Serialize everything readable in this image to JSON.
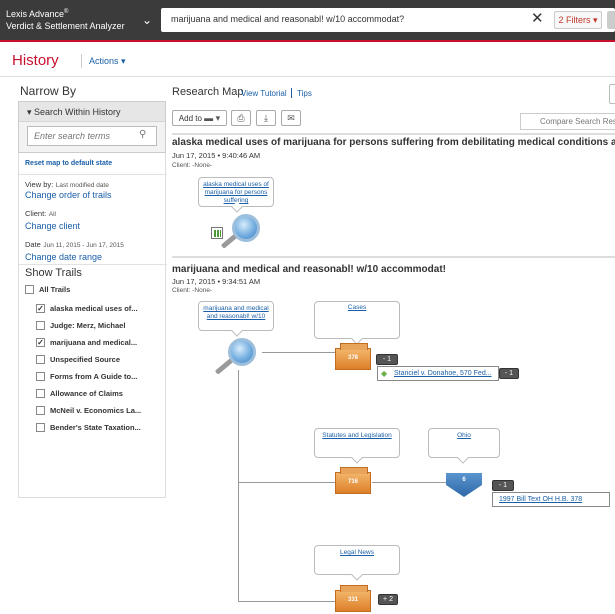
{
  "topbar": {
    "brand_line1": "Lexis Advance",
    "brand_sup": "®",
    "brand_line2": "Verdict & Settlement Analyzer",
    "chevron": "⌄",
    "search_value": "marijuana and medical and reasonabl! w/10 accommodat?",
    "clear_icon": "✕",
    "filters_label": "2 Filters ▾"
  },
  "header": {
    "title": "History",
    "actions_label": "Actions ▾"
  },
  "narrow_by": {
    "title": "Narrow By",
    "search_within_label": "▾ Search Within History",
    "search_placeholder": "Enter search terms",
    "search_icon": "⚲",
    "reset_link": "Reset map to default state",
    "view_by_label": "View by:",
    "view_by_value": "Last modified date",
    "change_order_link": "Change order of trails",
    "client_label": "Client:",
    "client_value": "All",
    "change_client_link": "Change client",
    "date_label": "Date",
    "date_value": "Jun 11, 2015 - Jun 17, 2015",
    "change_date_link": "Change date range",
    "show_trails_title": "Show Trails",
    "all_trails_label": "All Trails",
    "trails": [
      {
        "label": "alaska medical uses of...",
        "checked": true
      },
      {
        "label": "Judge: Merz, Michael",
        "checked": false
      },
      {
        "label": "marijuana and medical...",
        "checked": true
      },
      {
        "label": "Unspecified Source",
        "checked": false
      },
      {
        "label": "Forms from A Guide to...",
        "checked": false
      },
      {
        "label": "Allowance of Claims",
        "checked": false
      },
      {
        "label": "McNeil v. Economics La...",
        "checked": false
      },
      {
        "label": "Bender's State Taxation...",
        "checked": false
      }
    ]
  },
  "research_map": {
    "title": "Research Map",
    "view_tutorial": "View Tutorial",
    "tips": "Tips",
    "add_to_label": "Add to",
    "compare_label": "Compare Search Res",
    "searches": [
      {
        "title": "alaska medical uses of marijuana for persons suffering from debilitating medical conditions act",
        "date": "Jun 17, 2015",
        "time": "9:40:46 AM",
        "client": "Client: -None-",
        "node_label": "alaska medical uses of marijuana for persons suffering"
      },
      {
        "title": "marijuana and medical and reasonabl! w/10 accommodat!",
        "date": "Jun 17, 2015",
        "time": "9:34:51 AM",
        "client": "Client: -None-",
        "node_label": "marijuana and medical and reasonabl! w/10",
        "branches": {
          "cases_label": "Cases",
          "cases_count": "378",
          "cases_badge": "- 1",
          "case_doc": "Stanciel v. Donahoe, 570 Fed...",
          "case_doc_badge": "- 1",
          "statutes_label": "Statutes and Legislation",
          "statutes_count": "716",
          "ohio_label": "Ohio",
          "ohio_count": "6",
          "ohio_badge": "- 1",
          "ohio_doc": "1997 Bill Text OH H.B. 378",
          "news_label": "Legal News",
          "news_count": "331",
          "news_badge": "+ 2"
        }
      }
    ]
  }
}
